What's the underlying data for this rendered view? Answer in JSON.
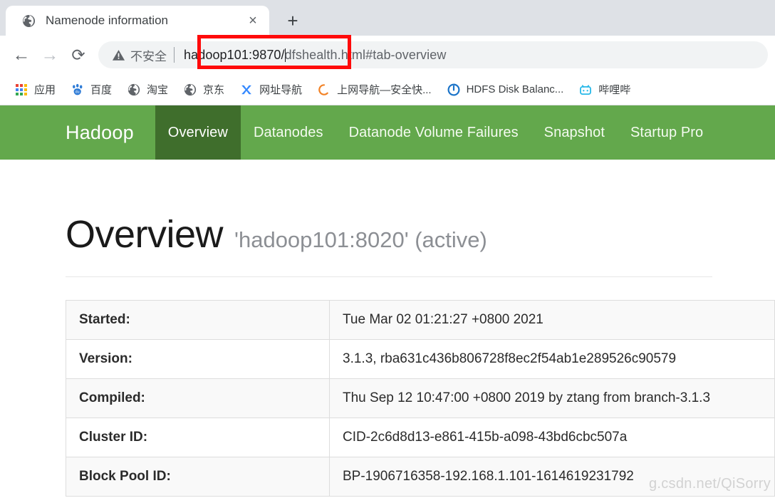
{
  "browser": {
    "tab": {
      "title": "Namenode information",
      "favicon": "globe-icon",
      "close_label": "×"
    },
    "new_tab_label": "+",
    "nav": {
      "back_label": "←",
      "forward_label": "→",
      "reload_label": "⟳"
    },
    "omnibox": {
      "security_icon": "warning-triangle-icon",
      "security_label": "不安全",
      "url_host": "hadoop101:9870/",
      "url_path": "dfshealth.html#tab-overview",
      "full_url": "hadoop101:9870/dfshealth.html#tab-overview"
    },
    "bookmarks": [
      {
        "label": "应用",
        "icon": "apps-grid-icon"
      },
      {
        "label": "百度",
        "icon": "baidu-paw-icon"
      },
      {
        "label": "淘宝",
        "icon": "globe-icon"
      },
      {
        "label": "京东",
        "icon": "globe-icon"
      },
      {
        "label": "网址导航",
        "icon": "hao123-icon"
      },
      {
        "label": "上网导航—安全快...",
        "icon": "ring-icon"
      },
      {
        "label": "HDFS Disk Balanc...",
        "icon": "hdfs-icon"
      },
      {
        "label": "哔哩哔",
        "icon": "bilibili-tv-icon"
      }
    ],
    "annotation": {
      "name": "red-highlight-rectangle",
      "color": "#ff0a0a"
    }
  },
  "hadoop": {
    "brand": "Hadoop",
    "nav_items": [
      {
        "label": "Overview",
        "active": true
      },
      {
        "label": "Datanodes",
        "active": false
      },
      {
        "label": "Datanode Volume Failures",
        "active": false
      },
      {
        "label": "Snapshot",
        "active": false
      },
      {
        "label": "Startup Pro",
        "active": false
      }
    ],
    "nav_colors": {
      "bar": "#63a84c",
      "active": "#3f6e2c",
      "text": "#ffffff"
    },
    "heading": {
      "title": "Overview",
      "subtitle": "'hadoop101:8020' (active)"
    },
    "overview_table": [
      {
        "key": "Started:",
        "value": "Tue Mar 02 01:21:27 +0800 2021"
      },
      {
        "key": "Version:",
        "value": "3.1.3, rba631c436b806728f8ec2f54ab1e289526c90579"
      },
      {
        "key": "Compiled:",
        "value": "Thu Sep 12 10:47:00 +0800 2019 by ztang from branch-3.1.3"
      },
      {
        "key": "Cluster ID:",
        "value": "CID-2c6d8d13-e861-415b-a098-43bd6cbc507a"
      },
      {
        "key": "Block Pool ID:",
        "value": "BP-1906716358-192.168.1.101-1614619231792"
      }
    ]
  },
  "watermark": "g.csdn.net/QiSorry"
}
